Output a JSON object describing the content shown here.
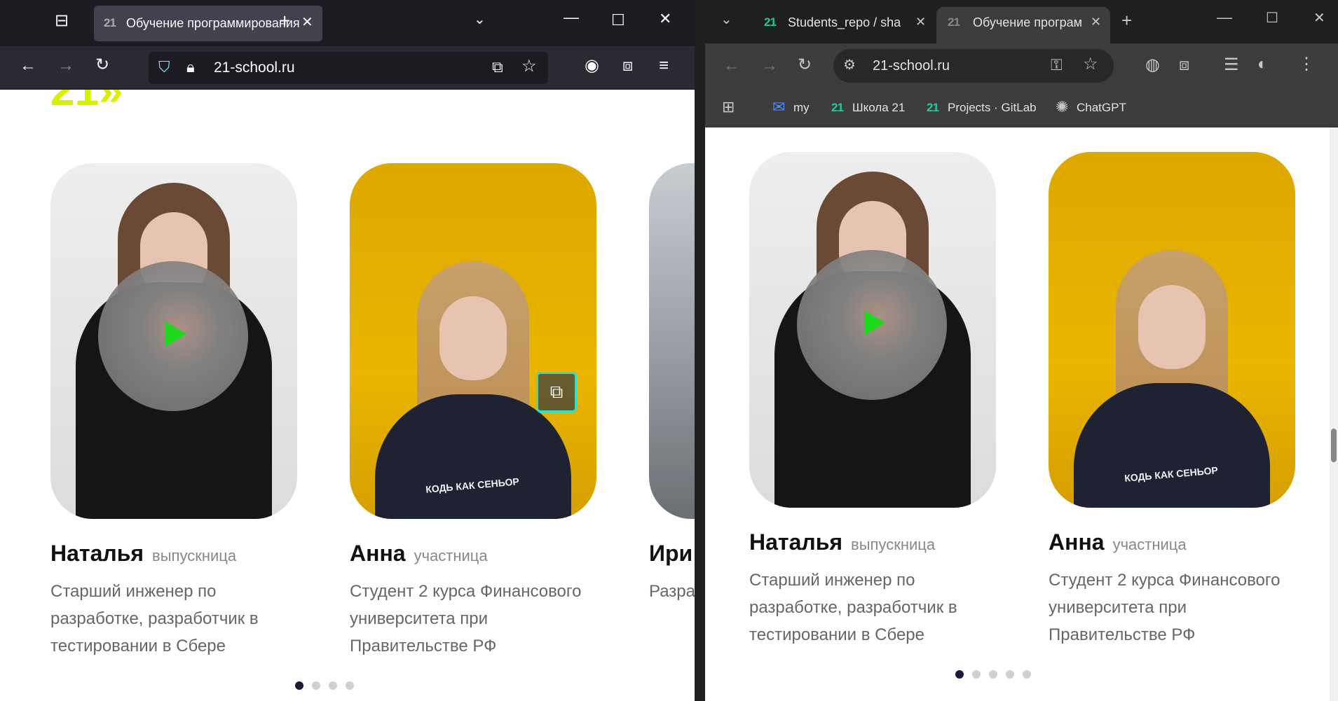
{
  "firefox": {
    "tab_title": "Обучение программирования",
    "url": "21-school.ru"
  },
  "chrome": {
    "tabs": [
      {
        "title": "Students_repo / sha"
      },
      {
        "title": "Обучение програм"
      }
    ],
    "url": "21-school.ru",
    "bookmarks": [
      {
        "label": "my"
      },
      {
        "label": "Школа 21"
      },
      {
        "label": "Projects · GitLab"
      },
      {
        "label": "ChatGPT"
      }
    ]
  },
  "page": {
    "logo_fragment": "21»",
    "cards": [
      {
        "name": "Наталья",
        "role": "выпускница",
        "description": "Старший инженер по разработке, разработчик в тестировании в Сбере"
      },
      {
        "name": "Анна",
        "role": "участница",
        "description": "Студент 2 курса Финансового университета при Правительстве РФ",
        "shirt_text": "КОДЬ КАК СЕНЬОР"
      },
      {
        "name": "Ири",
        "description": "Разра «Аква"
      }
    ],
    "pagination": {
      "total": 4,
      "active": 0
    },
    "pagination_chrome": {
      "total": 5,
      "active": 0
    }
  },
  "colors": {
    "accent_green": "#1ee91e",
    "logo_yellow": "#d8f000",
    "pip_border": "#2fe0c4"
  }
}
